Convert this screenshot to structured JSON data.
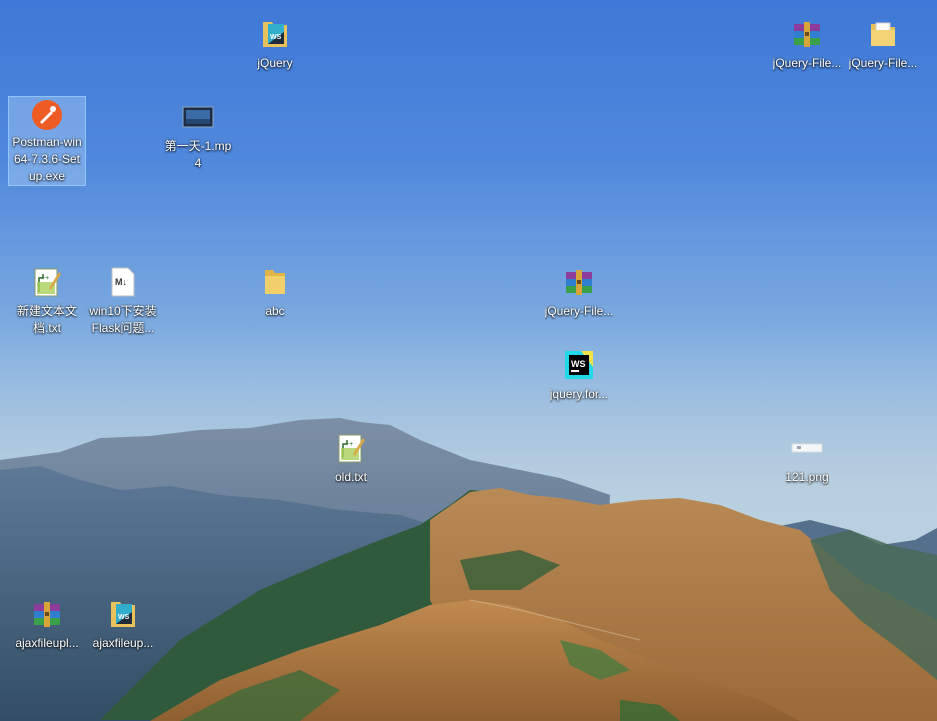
{
  "desktop": {
    "icons": [
      {
        "label": "jQuery",
        "icon": "webstorm-folder-icon"
      },
      {
        "label": "jQuery-File...",
        "icon": "winrar-archive-icon"
      },
      {
        "label": "jQuery-File...",
        "icon": "folder-icon"
      },
      {
        "label": "Postman-win64-7.3.6-Setup.exe",
        "icon": "postman-icon"
      },
      {
        "label": "第一天-1.mp4",
        "icon": "video-file-icon"
      },
      {
        "label": "新建文本文档.txt",
        "icon": "notepad-plus-plus-icon"
      },
      {
        "label": "win10下安装Flask问题...",
        "icon": "markdown-file-icon"
      },
      {
        "label": "abc",
        "icon": "folder-icon"
      },
      {
        "label": "jQuery-File...",
        "icon": "winrar-archive-icon"
      },
      {
        "label": "jquery.for...",
        "icon": "webstorm-icon"
      },
      {
        "label": "old.txt",
        "icon": "notepad-plus-plus-icon"
      },
      {
        "label": "121.png",
        "icon": "image-file-icon"
      },
      {
        "label": "ajaxfileupl...",
        "icon": "winrar-archive-icon"
      },
      {
        "label": "ajaxfileup...",
        "icon": "webstorm-folder-icon"
      }
    ]
  }
}
